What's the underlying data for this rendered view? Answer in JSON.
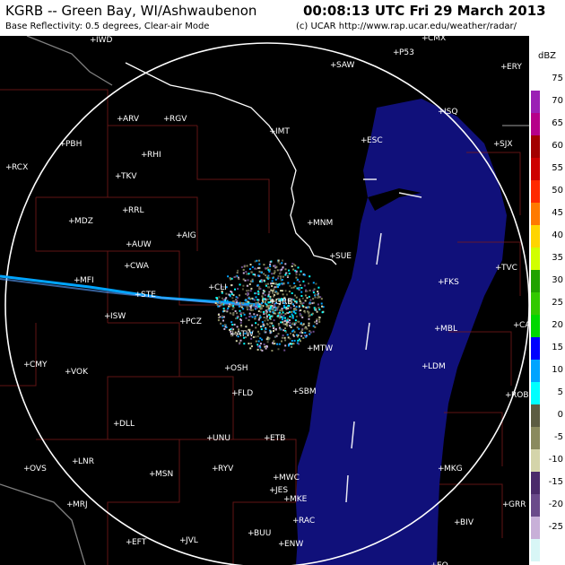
{
  "header": {
    "station": "KGRB -- Green Bay, WI/Ashwaubenon",
    "time": "00:08:13 UTC Fri 29 March 2013",
    "product": "Base Reflectivity: 0.5 degrees, Clear-air Mode",
    "credit": "(c) UCAR  http://www.rap.ucar.edu/weather/radar/"
  },
  "legend": {
    "unit": "dBZ",
    "items": [
      {
        "label": "75",
        "color": "#ffffff"
      },
      {
        "label": "70",
        "color": "#9b1fb5"
      },
      {
        "label": "65",
        "color": "#b60089"
      },
      {
        "label": "60",
        "color": "#a30000"
      },
      {
        "label": "55",
        "color": "#cd0000"
      },
      {
        "label": "50",
        "color": "#ff2a00"
      },
      {
        "label": "45",
        "color": "#ff7a00"
      },
      {
        "label": "40",
        "color": "#ffd500"
      },
      {
        "label": "35",
        "color": "#d1ff00"
      },
      {
        "label": "30",
        "color": "#1fa200"
      },
      {
        "label": "25",
        "color": "#32c900"
      },
      {
        "label": "20",
        "color": "#00d800"
      },
      {
        "label": "15",
        "color": "#0000ff"
      },
      {
        "label": "10",
        "color": "#00a4ff"
      },
      {
        "label": "5",
        "color": "#00ffff"
      },
      {
        "label": "0",
        "color": "#5c5c42"
      },
      {
        "label": "-5",
        "color": "#8a8a5e"
      },
      {
        "label": "-10",
        "color": "#d4d4aa"
      },
      {
        "label": "-15",
        "color": "#4a2a6a"
      },
      {
        "label": "-20",
        "color": "#6a4a8a"
      },
      {
        "label": "-25",
        "color": "#c8b0d8"
      },
      {
        "label": "",
        "color": "#d8f6f6"
      }
    ]
  },
  "cities": [
    "IWD",
    "SAW",
    "P53",
    "ERY",
    "CMX",
    "IMT",
    "ESC",
    "ISQ",
    "SJX",
    "ARV",
    "RGV",
    "RHI",
    "PBH",
    "RCX",
    "TKV",
    "RRL",
    "AUW",
    "AIG",
    "MDZ",
    "CWA",
    "MNM",
    "SUE",
    "TVC",
    "MFI",
    "STE",
    "CLI",
    "GRB",
    "FKS",
    "ISW",
    "PCZ",
    "ATW",
    "CAI",
    "MTW",
    "MBL",
    "CMY",
    "VOK",
    "OSH",
    "LDM",
    "FLD",
    "SBM",
    "ROB",
    "DLL",
    "UNU",
    "ETB",
    "LNR",
    "MSN",
    "RYV",
    "MWC",
    "MKG",
    "OVS",
    "JES",
    "MKE",
    "MRJ",
    "RAC",
    "BIV",
    "GRR",
    "EFT",
    "JVL",
    "BUU",
    "ENW",
    "EO"
  ],
  "map_layers": {
    "range_ring": "White range ring centered on KGRB",
    "lake": "Lake Michigan in dark blue",
    "boundaries": "State and county boundaries"
  }
}
